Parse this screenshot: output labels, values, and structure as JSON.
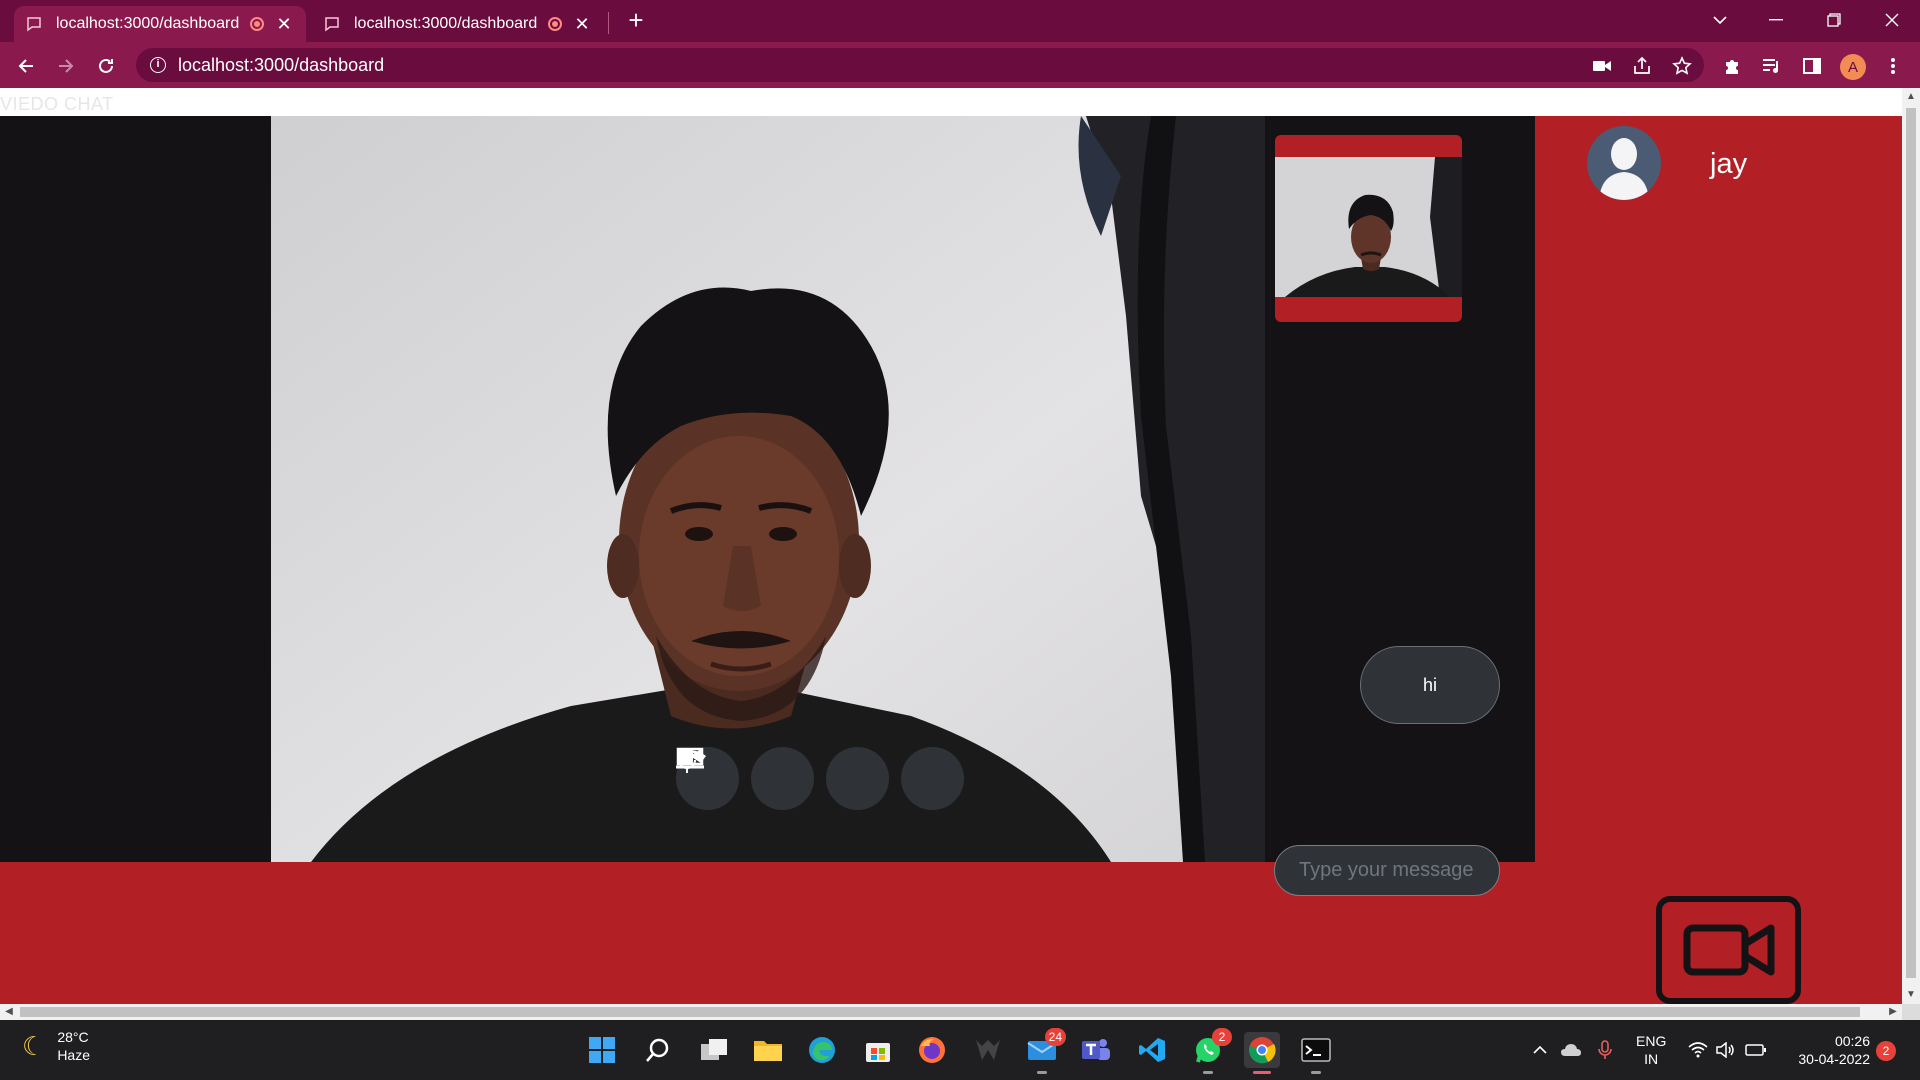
{
  "browser": {
    "tabs": [
      {
        "title": "localhost:3000/dashboard",
        "active": true
      },
      {
        "title": "localhost:3000/dashboard",
        "active": false
      }
    ],
    "close_glyph": "✕",
    "new_tab_glyph": "+",
    "url": "localhost:3000/dashboard",
    "profile_initial": "A"
  },
  "page": {
    "title": "VIEDO CHAT",
    "chat": {
      "messages": [
        {
          "text": "hi"
        }
      ],
      "input_placeholder": "Type your message"
    },
    "user": {
      "name": "jay"
    },
    "colors": {
      "accent": "#b22026",
      "dark": "#141214",
      "control": "#2f3338"
    }
  },
  "taskbar": {
    "weather": {
      "temp": "28°C",
      "condition": "Haze"
    },
    "mail_badge": "24",
    "whatsapp_badge": "2",
    "language": {
      "line1": "ENG",
      "line2": "IN"
    },
    "clock": {
      "time": "00:26",
      "date": "30-04-2022"
    },
    "notifications": "2"
  }
}
